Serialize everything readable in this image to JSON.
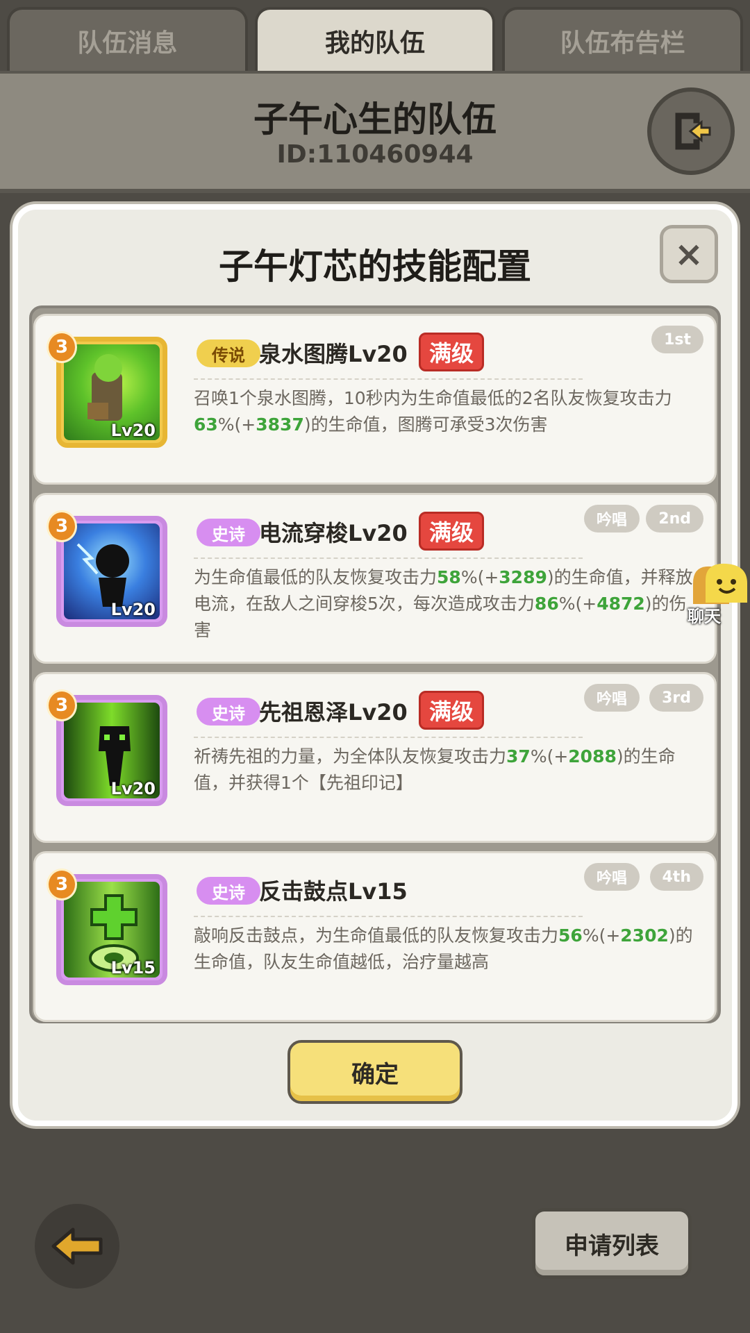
{
  "tabs": [
    {
      "label": "队伍消息",
      "active": false
    },
    {
      "label": "我的队伍",
      "active": true
    },
    {
      "label": "队伍布告栏",
      "active": false
    }
  ],
  "header": {
    "team_name": "子午心生的队伍",
    "team_id": "ID:110460944"
  },
  "modal": {
    "title": "子午灯芯的技能配置",
    "close_label": "×",
    "confirm_label": "确定"
  },
  "skills": [
    {
      "star": "3",
      "level_tag": "Lv20",
      "rarity": "传说",
      "name": "泉水图腾Lv20",
      "maxed": "满级",
      "chant": "",
      "order": "1st",
      "desc": [
        {
          "t": "召唤1个泉水图腾，10秒内为生命值最低的2名队友恢复"
        },
        {
          "t": "攻击力"
        },
        {
          "t": "63",
          "g": true
        },
        {
          "t": "%(+"
        },
        {
          "t": "3837",
          "g": true
        },
        {
          "t": ")的生命值，图腾可承受3次伤害"
        }
      ]
    },
    {
      "star": "3",
      "level_tag": "Lv20",
      "rarity": "史诗",
      "name": "电流穿梭Lv20",
      "maxed": "满级",
      "chant": "吟唱",
      "order": "2nd",
      "desc": [
        {
          "t": "为生命值最低的队友恢复攻击力"
        },
        {
          "t": "58",
          "g": true
        },
        {
          "t": "%(+"
        },
        {
          "t": "3289",
          "g": true
        },
        {
          "t": ")的生命值，"
        },
        {
          "t": "并释放电流，在敌人之间穿梭5次，每次造成攻击力"
        },
        {
          "t": "86",
          "g": true
        },
        {
          "t": "%("
        },
        {
          "t": "+"
        },
        {
          "t": "4872",
          "g": true
        },
        {
          "t": ")的伤害"
        }
      ]
    },
    {
      "star": "3",
      "level_tag": "Lv20",
      "rarity": "史诗",
      "name": "先祖恩泽Lv20",
      "maxed": "满级",
      "chant": "吟唱",
      "order": "3rd",
      "desc": [
        {
          "t": "祈祷先祖的力量，为全体队友恢复攻击力"
        },
        {
          "t": "37",
          "g": true
        },
        {
          "t": "%(+"
        },
        {
          "t": "2088",
          "g": true
        },
        {
          "t": ")的"
        },
        {
          "t": "生命值，并获得1个【先祖印记】"
        }
      ]
    },
    {
      "star": "3",
      "level_tag": "Lv15",
      "rarity": "史诗",
      "name": "反击鼓点Lv15",
      "maxed": "",
      "chant": "吟唱",
      "order": "4th",
      "desc": [
        {
          "t": "敲响反击鼓点，为生命值最低的队友恢复攻击力"
        },
        {
          "t": "56",
          "g": true
        },
        {
          "t": "%(+"
        },
        {
          "t": "23",
          "g": true
        },
        {
          "t": "02",
          "g": true
        },
        {
          "t": ")的生命值，队友生命值越低，治疗量越高"
        }
      ]
    }
  ],
  "footer": {
    "apply_label": "申请列表",
    "chat_label": "聊天"
  },
  "icons": [
    "exit-icon",
    "close-icon",
    "back-arrow-icon",
    "chat-icon"
  ]
}
